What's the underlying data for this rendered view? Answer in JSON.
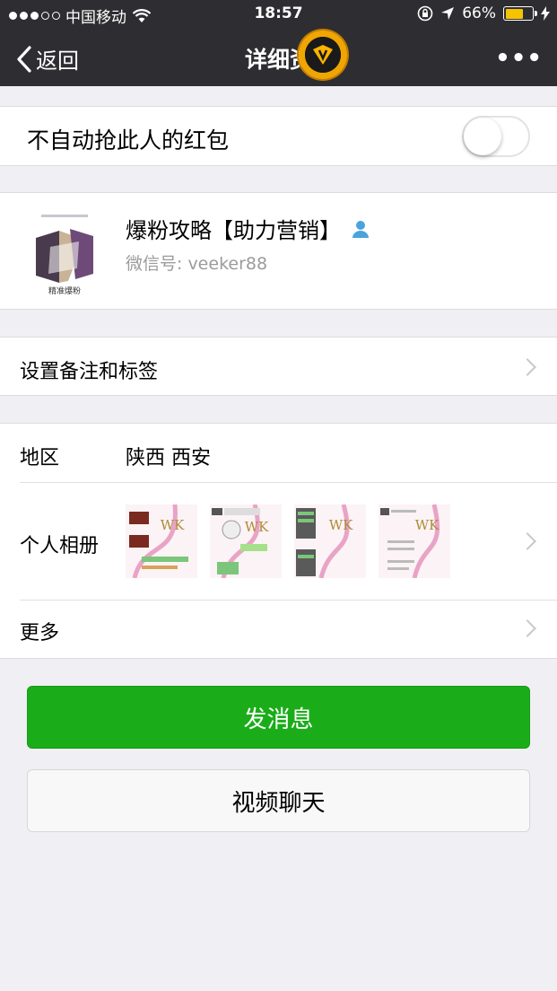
{
  "status_bar": {
    "carrier": "中国移动",
    "time": "18:57",
    "battery": "66%",
    "battery_level": 0.66,
    "icons": [
      "signal-dots-icon",
      "wifi-icon",
      "rotation-lock-icon",
      "location-arrow-icon",
      "battery-icon",
      "charging-bolt-icon"
    ]
  },
  "nav": {
    "back_label": "返回",
    "title": "详细资",
    "more_label": "•••"
  },
  "toggle": {
    "label": "不自动抢此人的红包",
    "on": false
  },
  "profile": {
    "name": "爆粉攻略【助力营销】",
    "wechat_id": "微信号:  veeker88",
    "logo_caption": "精准爆粉"
  },
  "cells": {
    "remark": "设置备注和标签",
    "region_label": "地区",
    "region_value": "陕西 西安",
    "album_label": "个人相册",
    "album_thumbs": [
      "WK",
      "WK",
      "WK",
      "WK"
    ],
    "more": "更多"
  },
  "buttons": {
    "send_message": "发消息",
    "video_chat": "视频聊天"
  },
  "colors": {
    "nav_bg": "#2e2e32",
    "primary_green": "#1aad19",
    "page_bg": "#efeff4"
  }
}
